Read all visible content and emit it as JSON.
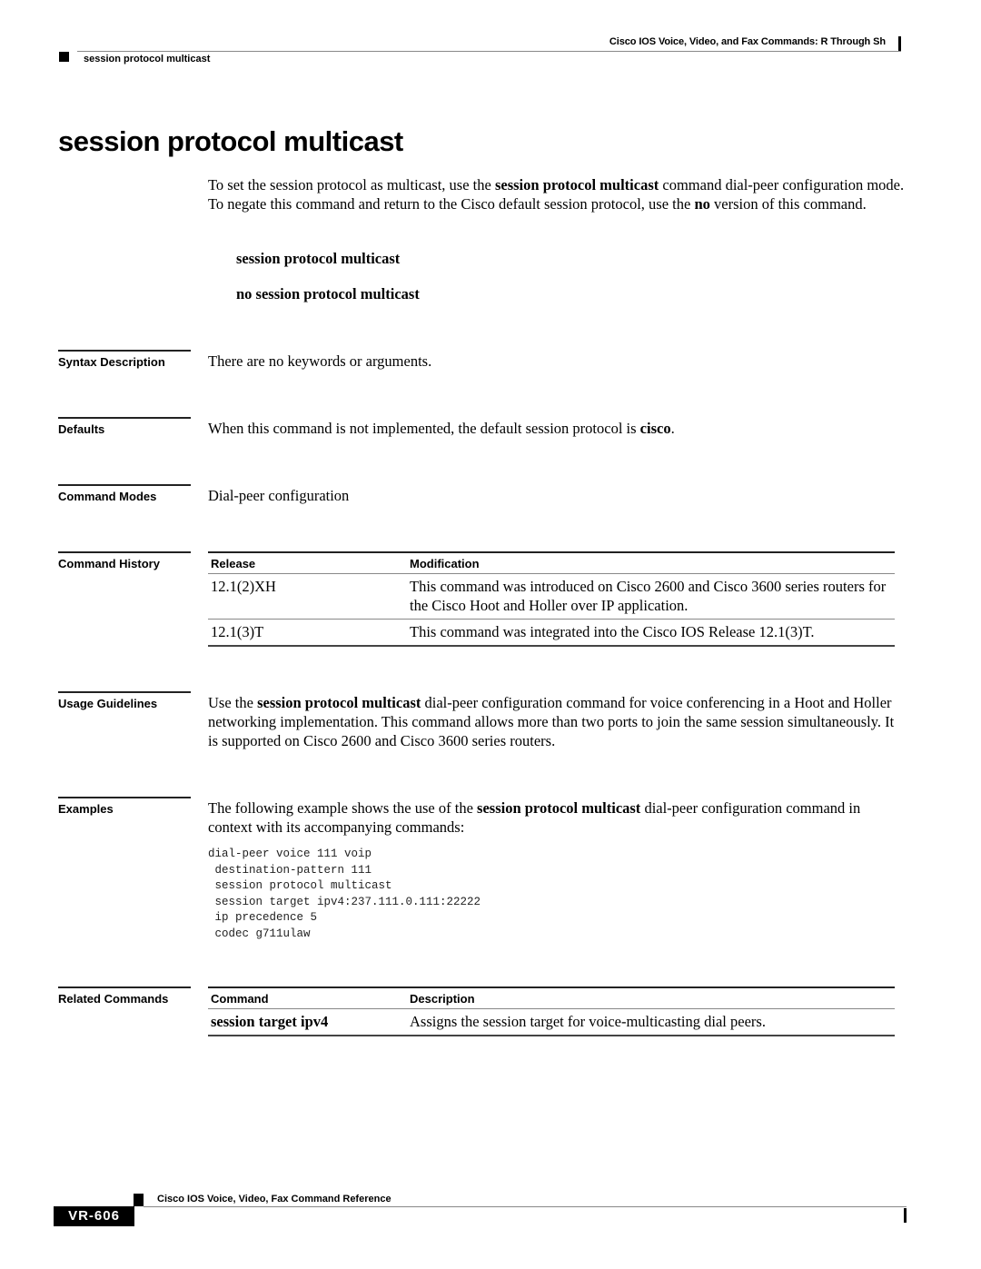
{
  "header": {
    "book_title": "Cisco IOS Voice, Video, and Fax Commands: R Through Sh",
    "section_label": "session protocol multicast"
  },
  "title": "session protocol multicast",
  "intro": {
    "parts": [
      {
        "text": "To set the session protocol as multicast, use the ",
        "bold": false
      },
      {
        "text": "session protocol multicast",
        "bold": true
      },
      {
        "text": " command dial-peer configuration mode. To negate this command and return to the Cisco default session protocol, use the ",
        "bold": false
      },
      {
        "text": "no",
        "bold": true
      },
      {
        "text": " version of this command.",
        "bold": false
      }
    ]
  },
  "syntax": {
    "line1": "session protocol multicast",
    "line2": "no session protocol multicast"
  },
  "sections": {
    "syntax_description": {
      "label": "Syntax Description",
      "text": "There are no keywords or arguments."
    },
    "defaults": {
      "label": "Defaults",
      "text_before": "When this command is not implemented, the default session protocol is ",
      "text_bold": "cisco",
      "text_after": "."
    },
    "command_modes": {
      "label": "Command Modes",
      "text": "Dial-peer configuration"
    },
    "command_history": {
      "label": "Command History",
      "columns": [
        "Release",
        "Modification"
      ],
      "rows": [
        {
          "release": "12.1(2)XH",
          "modification": "This command was introduced on Cisco 2600 and Cisco 3600 series routers for the Cisco Hoot and Holler over IP application."
        },
        {
          "release": "12.1(3)T",
          "modification": "This command was integrated into the Cisco IOS Release 12.1(3)T."
        }
      ]
    },
    "usage_guidelines": {
      "label": "Usage Guidelines",
      "text_before": "Use the ",
      "text_bold": "session protocol multicast",
      "text_after": " dial-peer configuration command for voice conferencing in a Hoot and Holler networking implementation. This command allows more than two ports to join the same session simultaneously. It is supported on Cisco 2600 and Cisco 3600 series routers."
    },
    "examples": {
      "label": "Examples",
      "text_before": "The following example shows the use of the ",
      "text_bold": "session protocol multicast",
      "text_after": " dial-peer configuration command in context with its accompanying commands:",
      "code": "dial-peer voice 111 voip\n destination-pattern 111\n session protocol multicast\n session target ipv4:237.111.0.111:22222\n ip precedence 5\n codec g711ulaw"
    },
    "related_commands": {
      "label": "Related Commands",
      "columns": [
        "Command",
        "Description"
      ],
      "rows": [
        {
          "command": "session target ipv4",
          "description": "Assigns the session target for voice-multicasting dial peers."
        }
      ]
    }
  },
  "footer": {
    "book_title": "Cisco IOS Voice, Video, Fax Command Reference",
    "page_number": "VR-606"
  }
}
